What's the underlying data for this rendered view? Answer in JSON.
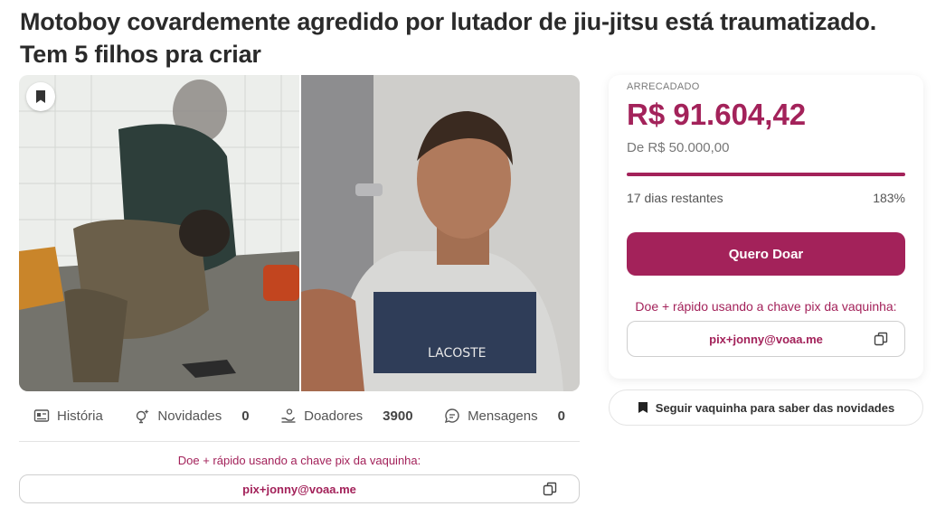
{
  "title": "Motoboy covardemente agredido por lutador de jiu-jitsu está traumatizado. Tem 5 filhos pra criar",
  "tabs": [
    {
      "label": "História",
      "icon": "article-icon"
    },
    {
      "label": "Novidades",
      "count": "0",
      "icon": "sparkle-icon"
    },
    {
      "label": "Doadores",
      "count": "3900",
      "icon": "donor-icon"
    },
    {
      "label": "Mensagens",
      "count": "0",
      "icon": "message-icon"
    }
  ],
  "pix": {
    "label": "Doe + rápido usando a chave pix da vaquinha:",
    "key": "pix+jonny@voaa.me"
  },
  "card": {
    "label": "ARRECADADO",
    "amount": "R$ 91.604,42",
    "goal": "De R$ 50.000,00",
    "progress": 1.0,
    "days": "17 dias restantes",
    "percent": "183%",
    "donate_button": "Quero Doar"
  },
  "follow_button": "Seguir vaquinha para saber das novidades",
  "colors": {
    "accent": "#a3225a",
    "text": "#2a2a2a"
  }
}
